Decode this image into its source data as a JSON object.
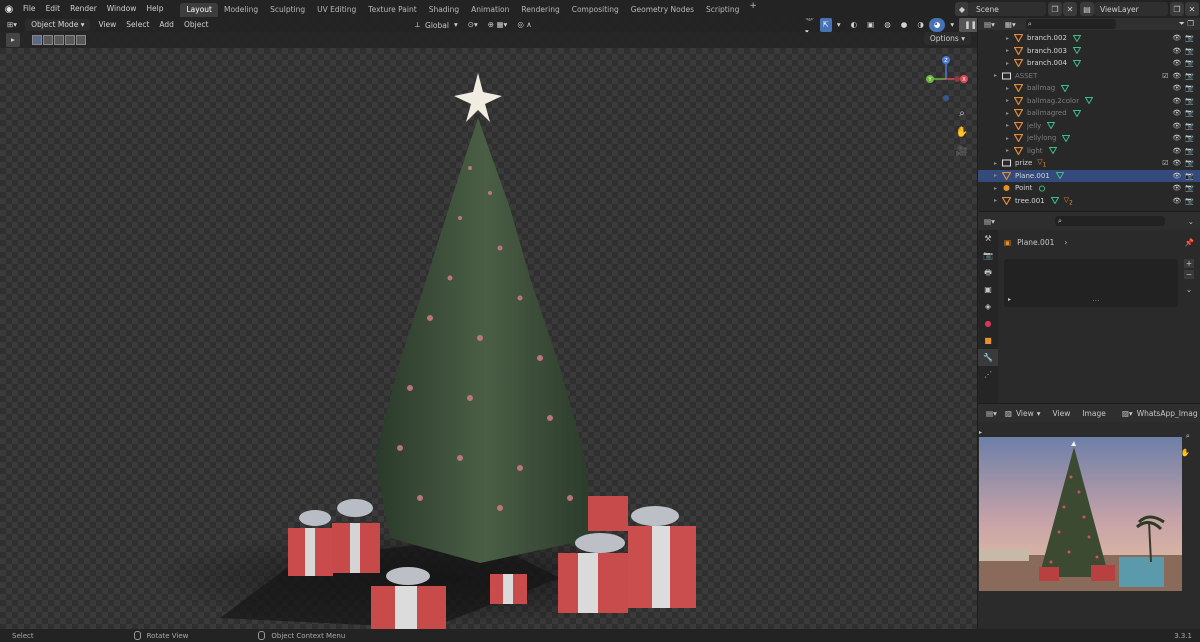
{
  "topbar": {
    "menus": [
      "File",
      "Edit",
      "Render",
      "Window",
      "Help"
    ],
    "workspaces": [
      "Layout",
      "Modeling",
      "Sculpting",
      "UV Editing",
      "Texture Paint",
      "Shading",
      "Animation",
      "Rendering",
      "Compositing",
      "Geometry Nodes",
      "Scripting"
    ],
    "active_workspace": "Layout",
    "add_workspace": "+",
    "scene": "Scene",
    "view_layer": "ViewLayer"
  },
  "viewport": {
    "mode": "Object Mode",
    "menus": [
      "View",
      "Select",
      "Add",
      "Object"
    ],
    "orientation": "Global",
    "options": "Options",
    "gizmo_axes": [
      "X",
      "Y",
      "Z"
    ]
  },
  "outliner": {
    "search_icon": "search-icon",
    "rows": [
      {
        "label": "branch.002",
        "depth": 2,
        "dim": false,
        "selected": false
      },
      {
        "label": "branch.003",
        "depth": 2,
        "dim": false,
        "selected": false
      },
      {
        "label": "branch.004",
        "depth": 2,
        "dim": false,
        "selected": false
      },
      {
        "label": "ASSET",
        "depth": 1,
        "dim": true,
        "selected": false,
        "collection": true
      },
      {
        "label": "ballmag",
        "depth": 2,
        "dim": true,
        "selected": false
      },
      {
        "label": "ballmag.2color",
        "depth": 2,
        "dim": true,
        "selected": false
      },
      {
        "label": "ballmagred",
        "depth": 2,
        "dim": true,
        "selected": false
      },
      {
        "label": "jelly",
        "depth": 2,
        "dim": true,
        "selected": false
      },
      {
        "label": "jellylong",
        "depth": 2,
        "dim": true,
        "selected": false
      },
      {
        "label": "light",
        "depth": 2,
        "dim": true,
        "selected": false
      },
      {
        "label": "prize",
        "depth": 1,
        "dim": false,
        "selected": false,
        "collection": true,
        "badge": "1"
      },
      {
        "label": "Plane.001",
        "depth": 1,
        "dim": false,
        "selected": true
      },
      {
        "label": "Point",
        "depth": 1,
        "dim": false,
        "selected": false
      },
      {
        "label": "tree.001",
        "depth": 1,
        "dim": false,
        "selected": false,
        "badge": "2"
      }
    ]
  },
  "properties": {
    "object_name": "Plane.001",
    "add_btn": "+",
    "remove_btn": "−"
  },
  "image_editor": {
    "menus": [
      "View",
      "View",
      "Image"
    ],
    "image_name": "WhatsApp_Image_"
  },
  "status": {
    "items": [
      "Select",
      "Rotate View",
      "Object Context Menu"
    ],
    "version": "3.3.1"
  },
  "colors": {
    "accent": "#4772b3",
    "selected_row": "#334a7a",
    "mesh_icon": "#e08a3a",
    "modifier_icon": "#3dbd89"
  }
}
